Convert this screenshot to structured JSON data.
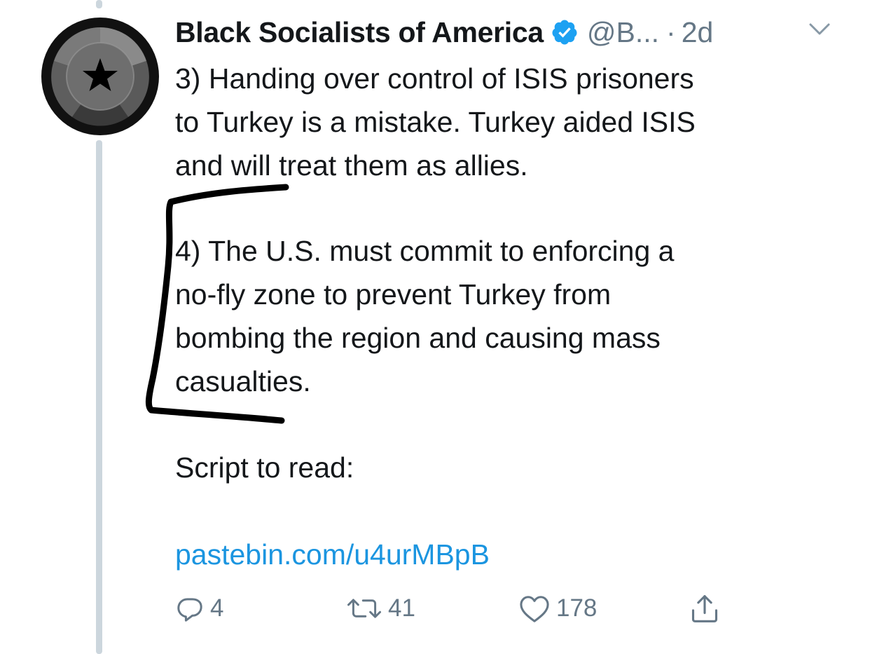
{
  "tweet": {
    "display_name": "Black Socialists of America",
    "handle": "@B...",
    "separator": "·",
    "time": "2d",
    "paragraphs": [
      "3) Handing over control of ISIS prisoners\nto Turkey is a mistake. Turkey aided ISIS\nand will treat them as allies.",
      "4) The U.S. must commit to enforcing a\nno-fly zone to prevent Turkey from\nbombing the region and causing mass\ncasualties.",
      "Script to read:"
    ],
    "link_text": "pastebin.com/u4urMBpB"
  },
  "actions": {
    "reply_count": "4",
    "retweet_count": "41",
    "like_count": "178"
  },
  "icons": {
    "avatar": "black-star-avatar-icon",
    "verified": "verified-badge-icon",
    "menu": "chevron-down-icon",
    "reply": "reply-icon",
    "retweet": "retweet-icon",
    "like": "heart-icon",
    "share": "share-icon"
  },
  "colors": {
    "text": "#14171a",
    "secondary": "#657786",
    "link": "#1b95e0",
    "verified": "#1da1f2",
    "thread_line": "#ccd6dd",
    "annotation": "#000000"
  }
}
